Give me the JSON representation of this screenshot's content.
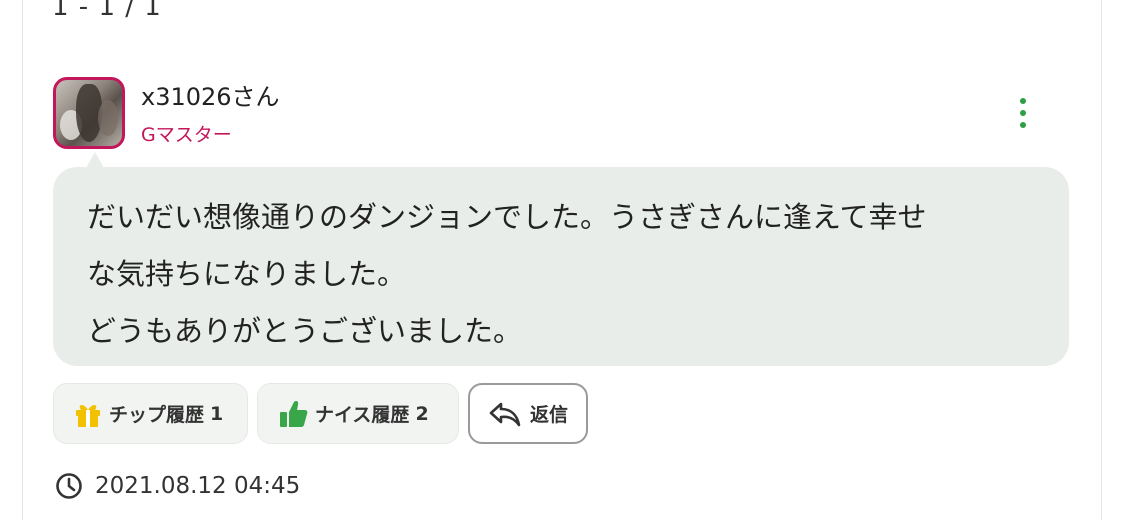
{
  "pager": {
    "text": "1 - 1 / 1"
  },
  "comment": {
    "username": "x31026さん",
    "rank": "Gマスター",
    "body_lines": [
      "だいだい想像通りのダンジョンでした。うさぎさんに逢えて幸せ",
      "な気持ちになりました。",
      "どうもありがとうございました。"
    ],
    "actions": {
      "tip_history": {
        "label": "チップ履歴",
        "count": "1",
        "icon": "gift-icon"
      },
      "nice_history": {
        "label": "ナイス履歴",
        "count": "2",
        "icon": "thumbs-up-icon"
      },
      "reply": {
        "label": "返信",
        "icon": "reply-icon"
      }
    },
    "timestamp": "2021.08.12 04:45",
    "menu_icon": "more-vertical-icon"
  },
  "colors": {
    "rank": "#c2185b",
    "avatar_border": "#c2185b",
    "menu_dots": "#2e9e44",
    "gift": "#f2c200",
    "thumb": "#3aa64a",
    "bubble_bg": "#e9ede9"
  }
}
